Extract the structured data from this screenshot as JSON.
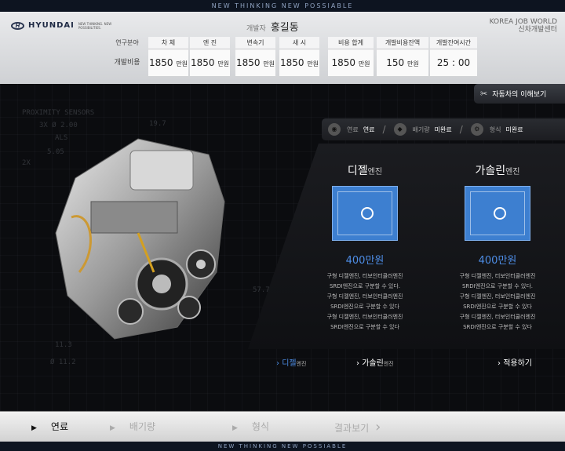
{
  "top_tagline": "NEW THINKING NEW POSSIABLE",
  "bottom_tagline": "NEW THINKING NEW POSSIABLE",
  "brand": {
    "name": "HYUNDAI",
    "sub": "NEW THINKING. NEW POSSIBILITIES."
  },
  "developer": {
    "label": "개발자",
    "name": "홍길동"
  },
  "center": {
    "line1": "KOREA JOB WORLD",
    "line2": "신차개발센터"
  },
  "cost_table": {
    "row_label_top": "연구분야",
    "row_label_bottom": "개발비용",
    "columns": [
      {
        "header": "차 체",
        "value": "1850",
        "unit": "만원"
      },
      {
        "header": "엔 진",
        "value": "1850",
        "unit": "만원"
      },
      {
        "header": "변속기",
        "value": "1850",
        "unit": "만원"
      },
      {
        "header": "새 시",
        "value": "1850",
        "unit": "만원"
      }
    ],
    "summary": [
      {
        "header": "비용 합계",
        "value": "1850",
        "unit": "만원"
      },
      {
        "header": "개발비용잔액",
        "value": "150",
        "unit": "만원"
      },
      {
        "header": "개발잔여시간",
        "value": "25 : 00",
        "unit": ""
      }
    ]
  },
  "learn_button": "자동차의 이해보기",
  "status": {
    "fuel_label": "연료",
    "fuel_value": "연료",
    "disp_label": "배기량",
    "disp_value": "미완료",
    "type_label": "형식",
    "type_value": "미완료"
  },
  "options": [
    {
      "title": "디젤",
      "suffix": "엔진",
      "price": "400만원",
      "desc": [
        "구형 디젤엔진, 터보인터쿨러엔진",
        "SRDI엔진으로 구분할 수 있다.",
        "구형 디젤엔진, 터보인터쿨러엔진",
        "SRDI엔진으로 구분할 수 있다",
        "구형 디젤엔진, 터보인터쿨러엔진",
        "SRDI엔진으로 구분할 수 있다"
      ]
    },
    {
      "title": "가솔린",
      "suffix": "엔진",
      "price": "400만원",
      "desc": [
        "구형 디젤엔진, 터보인터쿨러엔진",
        "SRDI엔진으로 구분할 수 있다.",
        "구형 디젤엔진, 터보인터쿨러엔진",
        "SRDI엔진으로 구분할 수 있다",
        "구형 디젤엔진, 터보인터쿨러엔진",
        "SRDI엔진으로 구분할 수 있다"
      ]
    }
  ],
  "actions": {
    "diesel": "디젤",
    "diesel_suffix": "엔진",
    "gasoline": "가솔린",
    "gasoline_suffix": "엔진",
    "apply": "적용하기"
  },
  "steps": [
    "연료",
    "배기량",
    "형식",
    "결과보기"
  ],
  "blueprint": [
    "PROXIMITY SENSORS",
    "3X Ø 2.00",
    "ALS",
    "5.05",
    "2X",
    "19.7",
    "57.75",
    "11.3",
    "Ø 11.2"
  ]
}
